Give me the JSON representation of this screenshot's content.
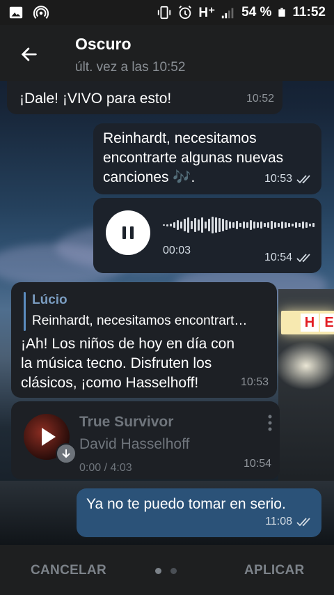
{
  "status_bar": {
    "network": "H⁺",
    "battery": "54 %",
    "time": "11:52",
    "icons": [
      "image-icon",
      "hotspot-icon",
      "vibrate-icon",
      "alarm-icon",
      "signal-icon",
      "battery-icon"
    ]
  },
  "header": {
    "name": "Oscuro",
    "last_seen": "últ. vez a las 10:52"
  },
  "wallpaper": {
    "sign_letters": [
      "H",
      "E"
    ]
  },
  "messages": {
    "m1": {
      "text": "¡Dale! ¡VIVO para esto!",
      "time": "10:52"
    },
    "m2": {
      "line1": "Reinhardt, necesitamos",
      "line2": "encontrarte algunas nuevas",
      "line3": "canciones 🎶.",
      "time": "10:53"
    },
    "voice": {
      "duration": "00:03",
      "time": "10:54",
      "playing": true
    },
    "m3": {
      "reply_author": "Lúcio",
      "reply_text": "Reinhardt, necesitamos encontrart…",
      "line1": "¡Ah! Los niños de hoy en día con",
      "line2": "la música tecno. Disfruten los",
      "line3": "clásicos, ¡como Hasselhoff!",
      "time": "10:53"
    },
    "music": {
      "title": "True Survivor",
      "artist": "David Hasselhoff",
      "progress": "0:00 / 4:03",
      "time": "10:54"
    },
    "m4": {
      "text": "Ya no te puedo tomar en serio.",
      "time": "11:08"
    }
  },
  "bottom": {
    "cancel": "CANCELAR",
    "apply": "APLICAR"
  },
  "colors": {
    "accent": "#5b8cbf",
    "out_bubble": "#2b5278",
    "in_bubble": "#1d2025"
  }
}
